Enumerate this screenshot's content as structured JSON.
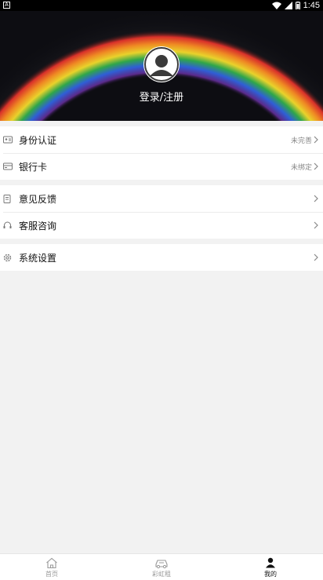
{
  "status_bar": {
    "left_badge": "A",
    "time": "1:45"
  },
  "profile": {
    "login_label": "登录/注册"
  },
  "menu": {
    "group1": [
      {
        "label": "身份认证",
        "status": "未完善",
        "icon": "id-card-icon"
      },
      {
        "label": "银行卡",
        "status": "未绑定",
        "icon": "bank-card-icon"
      }
    ],
    "group2": [
      {
        "label": "意见反馈",
        "icon": "feedback-icon"
      },
      {
        "label": "客服咨询",
        "icon": "headset-icon"
      }
    ],
    "group3": [
      {
        "label": "系统设置",
        "icon": "gear-icon"
      }
    ]
  },
  "tabs": [
    {
      "label": "首页",
      "icon": "home-icon"
    },
    {
      "label": "彩虹租",
      "icon": "car-icon"
    },
    {
      "label": "我的",
      "icon": "user-icon",
      "active": true
    }
  ]
}
